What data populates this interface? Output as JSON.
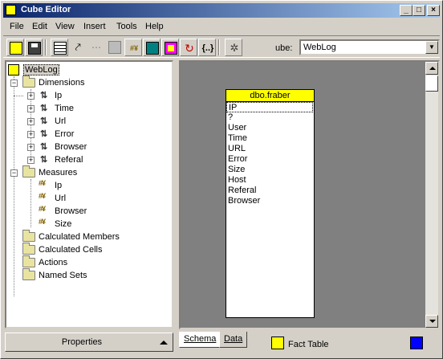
{
  "window": {
    "title": "Cube Editor"
  },
  "menu": [
    "File",
    "Edit",
    "View",
    "Insert",
    "Tools",
    "Help"
  ],
  "toolbar": {
    "cube_label": "ube:",
    "cube_value": "WebLog"
  },
  "tree": {
    "root": "WebLog",
    "dimensions_label": "Dimensions",
    "dimensions": [
      "Ip",
      "Time",
      "Url",
      "Error",
      "Browser",
      "Referal"
    ],
    "measures_label": "Measures",
    "measures": [
      "Ip",
      "Url",
      "Browser",
      "Size"
    ],
    "folders": [
      "Calculated Members",
      "Calculated Cells",
      "Actions",
      "Named Sets"
    ]
  },
  "properties_label": "Properties",
  "schema": {
    "table_name": "dbo.fraber",
    "fields": [
      "IP",
      "?",
      "User",
      "Time",
      "URL",
      "Error",
      "Size",
      "Host",
      "Referal",
      "Browser"
    ]
  },
  "tabs": {
    "schema": "Schema",
    "data": "Data"
  },
  "legend": {
    "fact_table": "Fact Table",
    "fact_color": "#ffff00",
    "dim_color": "#0000ff"
  }
}
